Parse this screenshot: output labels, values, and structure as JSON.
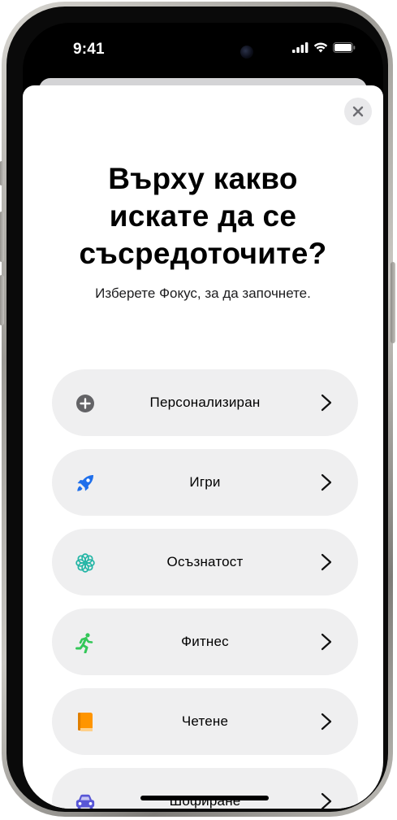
{
  "status_bar": {
    "time": "9:41",
    "icons": [
      "cellular-signal-icon",
      "wifi-icon",
      "battery-icon"
    ]
  },
  "sheet": {
    "title_lines": [
      "Върху какво",
      "искате да се",
      "съсредоточите?"
    ],
    "subtitle": "Изберете Фокус, за да започнете.",
    "close_icon": "close-icon"
  },
  "options": [
    {
      "label": "Персонализиран",
      "icon": "plus-circle-icon",
      "color": "#636366"
    },
    {
      "label": "Игри",
      "icon": "rocket-icon",
      "color": "#1f6feb"
    },
    {
      "label": "Осъзнатост",
      "icon": "flower-icon",
      "color": "#22b5a5"
    },
    {
      "label": "Фитнес",
      "icon": "running-figure-icon",
      "color": "#34c759"
    },
    {
      "label": "Четене",
      "icon": "book-icon",
      "color": "#ff9500"
    },
    {
      "label": "Шофиране",
      "icon": "car-icon",
      "color": "#5856d6"
    }
  ]
}
